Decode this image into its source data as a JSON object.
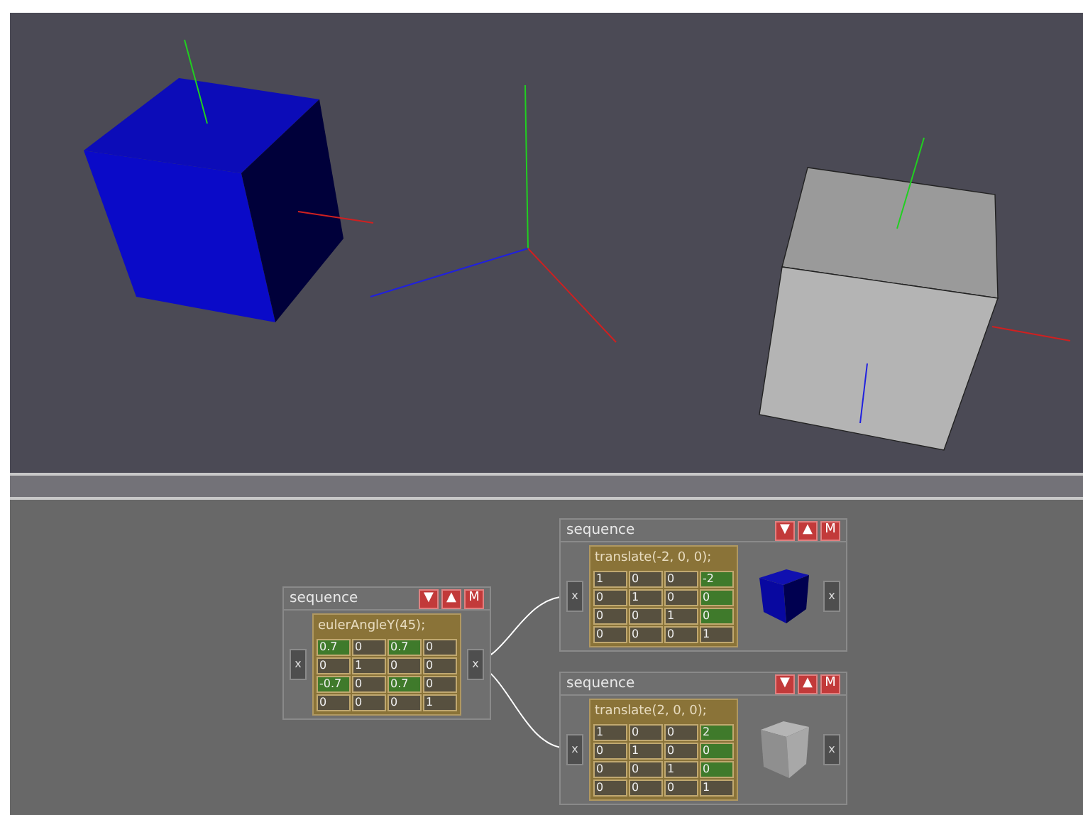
{
  "nodes": [
    {
      "title": "sequence",
      "buttons": [
        "▼",
        "▲",
        "M"
      ],
      "in_port": "x",
      "out_port": "x",
      "expression": "eulerAngleY(45);",
      "matrix": [
        [
          {
            "value": "0.7",
            "highlighted": true
          },
          {
            "value": "0",
            "highlighted": false
          },
          {
            "value": "0.7",
            "highlighted": true
          },
          {
            "value": "0",
            "highlighted": false
          }
        ],
        [
          {
            "value": "0",
            "highlighted": false
          },
          {
            "value": "1",
            "highlighted": false
          },
          {
            "value": "0",
            "highlighted": false
          },
          {
            "value": "0",
            "highlighted": false
          }
        ],
        [
          {
            "value": "-0.7",
            "highlighted": true
          },
          {
            "value": "0",
            "highlighted": false
          },
          {
            "value": "0.7",
            "highlighted": true
          },
          {
            "value": "0",
            "highlighted": false
          }
        ],
        [
          {
            "value": "0",
            "highlighted": false
          },
          {
            "value": "0",
            "highlighted": false
          },
          {
            "value": "0",
            "highlighted": false
          },
          {
            "value": "1",
            "highlighted": false
          }
        ]
      ]
    },
    {
      "title": "sequence",
      "buttons": [
        "▼",
        "▲",
        "M"
      ],
      "in_port": "x",
      "out_port": "x",
      "expression": "translate(-2, 0, 0);",
      "preview": {
        "kind": "blue-cube"
      },
      "matrix": [
        [
          {
            "value": "1",
            "highlighted": false
          },
          {
            "value": "0",
            "highlighted": false
          },
          {
            "value": "0",
            "highlighted": false
          },
          {
            "value": "-2",
            "highlighted": true
          }
        ],
        [
          {
            "value": "0",
            "highlighted": false
          },
          {
            "value": "1",
            "highlighted": false
          },
          {
            "value": "0",
            "highlighted": false
          },
          {
            "value": "0",
            "highlighted": true
          }
        ],
        [
          {
            "value": "0",
            "highlighted": false
          },
          {
            "value": "0",
            "highlighted": false
          },
          {
            "value": "1",
            "highlighted": false
          },
          {
            "value": "0",
            "highlighted": true
          }
        ],
        [
          {
            "value": "0",
            "highlighted": false
          },
          {
            "value": "0",
            "highlighted": false
          },
          {
            "value": "0",
            "highlighted": false
          },
          {
            "value": "1",
            "highlighted": false
          }
        ]
      ]
    },
    {
      "title": "sequence",
      "buttons": [
        "▼",
        "▲",
        "M"
      ],
      "in_port": "x",
      "out_port": "x",
      "expression": "translate(2, 0, 0);",
      "preview": {
        "kind": "gray-cube"
      },
      "matrix": [
        [
          {
            "value": "1",
            "highlighted": false
          },
          {
            "value": "0",
            "highlighted": false
          },
          {
            "value": "0",
            "highlighted": false
          },
          {
            "value": "2",
            "highlighted": true
          }
        ],
        [
          {
            "value": "0",
            "highlighted": false
          },
          {
            "value": "1",
            "highlighted": false
          },
          {
            "value": "0",
            "highlighted": false
          },
          {
            "value": "0",
            "highlighted": true
          }
        ],
        [
          {
            "value": "0",
            "highlighted": false
          },
          {
            "value": "0",
            "highlighted": false
          },
          {
            "value": "1",
            "highlighted": false
          },
          {
            "value": "0",
            "highlighted": true
          }
        ],
        [
          {
            "value": "0",
            "highlighted": false
          },
          {
            "value": "0",
            "highlighted": false
          },
          {
            "value": "0",
            "highlighted": false
          },
          {
            "value": "1",
            "highlighted": false
          }
        ]
      ]
    }
  ]
}
